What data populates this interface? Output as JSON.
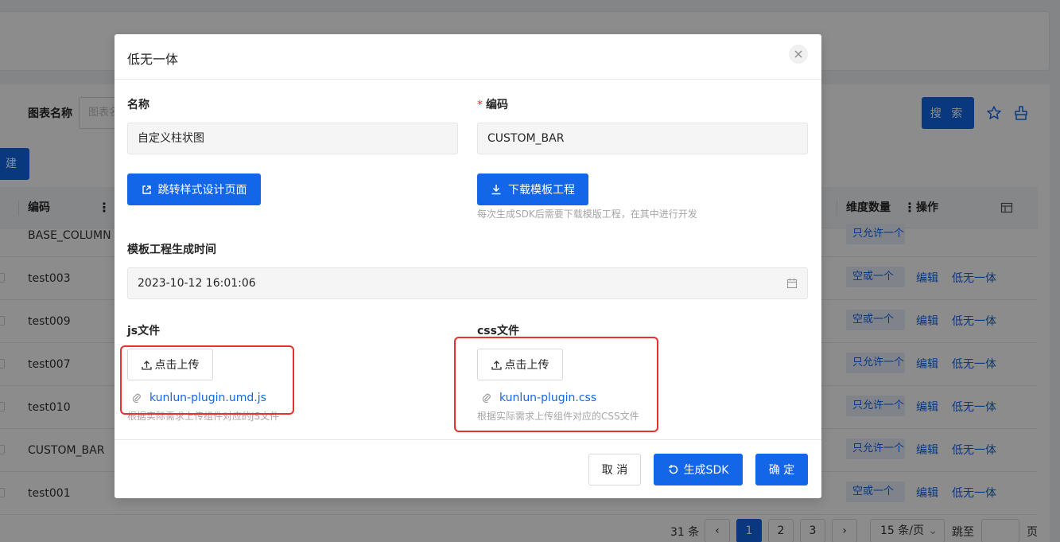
{
  "background": {
    "search_label": "图表名称",
    "search_placeholder": "图表名",
    "search_button": "搜 索",
    "new_button": "建",
    "table": {
      "headers": {
        "code": "编码",
        "dimension_count": "维度数量",
        "operations": "操作"
      },
      "rows": [
        {
          "code": "BASE_COLUMN",
          "dimension": "只允许一个",
          "edit": "",
          "low_code": ""
        },
        {
          "code": "test003",
          "dimension": "空或一个",
          "edit": "编辑",
          "low_code": "低无一体"
        },
        {
          "code": "test009",
          "dimension": "空或一个",
          "edit": "编辑",
          "low_code": "低无一体"
        },
        {
          "code": "test007",
          "dimension": "只允许一个",
          "edit": "编辑",
          "low_code": "低无一体"
        },
        {
          "code": "test010",
          "dimension": "只允许一个",
          "edit": "编辑",
          "low_code": "低无一体"
        },
        {
          "code": "CUSTOM_BAR",
          "dimension": "只允许一个",
          "edit": "编辑",
          "low_code": "低无一体"
        },
        {
          "code": "test001",
          "dimension": "空或一个",
          "edit": "编辑",
          "low_code": "低无一体"
        }
      ]
    },
    "pagination": {
      "total": "31 条",
      "pages": [
        "1",
        "2",
        "3"
      ],
      "current_page": "1",
      "page_size": "15 条/页",
      "goto_label": "跳至",
      "page_suffix": "页"
    }
  },
  "modal": {
    "title": "低无一体",
    "name_label": "名称",
    "name_value": "自定义柱状图",
    "code_label": "编码",
    "code_value": "CUSTOM_BAR",
    "jump_button": "跳转样式设计页面",
    "download_button": "下载模板工程",
    "download_hint": "每次生成SDK后需要下载模版工程，在其中进行开发",
    "gen_time_label": "模板工程生成时间",
    "gen_time_value": "2023-10-12 16:01:06",
    "js_label": "js文件",
    "js_upload_button": "点击上传",
    "js_file": "kunlun-plugin.umd.js",
    "js_hint": "根据实际需求上传组件对应的JS文件",
    "css_label": "css文件",
    "css_upload_button": "点击上传",
    "css_file": "kunlun-plugin.css",
    "css_hint": "根据实际需求上传组件对应的CSS文件",
    "cancel_button": "取 消",
    "generate_button": "生成SDK",
    "confirm_button": "确 定"
  },
  "colors": {
    "primary": "#1366e8",
    "annotation_red": "#e8302c",
    "required": "#f5222d"
  }
}
